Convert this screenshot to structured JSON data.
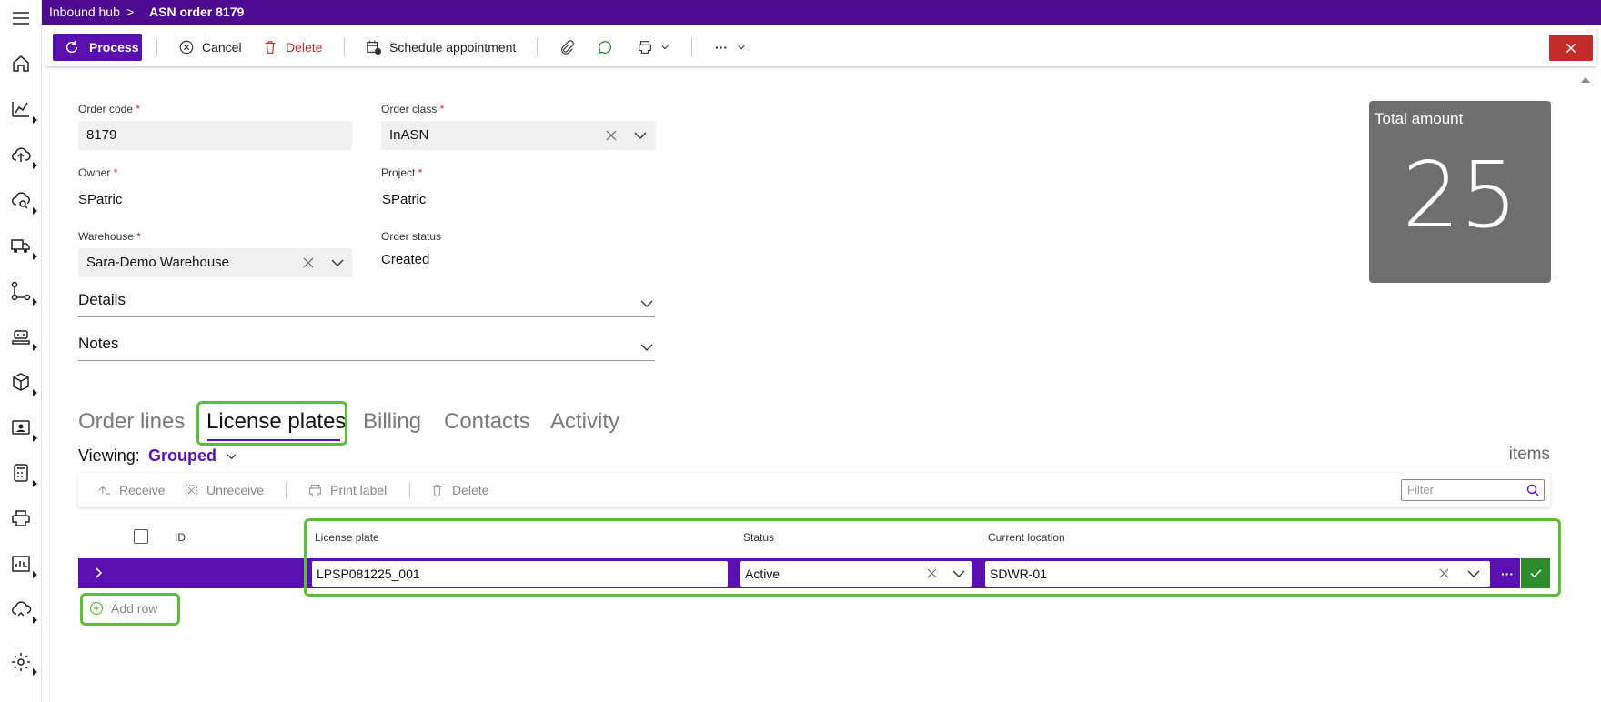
{
  "breadcrumb": {
    "parent": "Inbound hub",
    "separator": ">",
    "current": "ASN order 8179"
  },
  "toolbar": {
    "process_label": "Process",
    "cancel_label": "Cancel",
    "delete_label": "Delete",
    "schedule_label": "Schedule appointment",
    "more_label": "···"
  },
  "form": {
    "order_code": {
      "label": "Order code",
      "required": "*",
      "value": "8179"
    },
    "order_class": {
      "label": "Order class",
      "required": "*",
      "value": "InASN"
    },
    "owner": {
      "label": "Owner",
      "required": "*",
      "value": "SPatric"
    },
    "project": {
      "label": "Project",
      "required": "*",
      "value": "SPatric"
    },
    "warehouse": {
      "label": "Warehouse",
      "required": "*",
      "value": "Sara-Demo Warehouse"
    },
    "order_status": {
      "label": "Order status",
      "value": "Created"
    }
  },
  "sections": {
    "details": "Details",
    "notes": "Notes"
  },
  "total_card": {
    "label": "Total amount",
    "value": "25"
  },
  "tabs": [
    {
      "label": "Order lines"
    },
    {
      "label": "License plates",
      "active": true
    },
    {
      "label": "Billing"
    },
    {
      "label": "Contacts"
    },
    {
      "label": "Activity"
    }
  ],
  "viewing": {
    "label": "Viewing:",
    "value": "Grouped"
  },
  "items_label": "items",
  "grid_toolbar": {
    "receive": "Receive",
    "unreceive": "Unreceive",
    "print_label": "Print label",
    "delete": "Delete",
    "filter_placeholder": "Filter"
  },
  "grid": {
    "columns": {
      "id": "ID",
      "license_plate": "License plate",
      "status": "Status",
      "current_location": "Current location"
    },
    "rows": [
      {
        "license_plate": "LPSP081225_001",
        "status": "Active",
        "current_location": "SDWR-01"
      }
    ],
    "more_label": "···",
    "add_row_label": "Add row"
  },
  "colors": {
    "brand": "#4b0a8f",
    "accent": "#5a10b0",
    "highlight": "#5fbb3f",
    "danger": "#c42b2b",
    "confirm": "#2e8b2e"
  },
  "rail_icons": [
    "menu-icon",
    "home-icon",
    "analytics-icon",
    "cloud-upload-icon",
    "cloud-search-icon",
    "truck-icon",
    "flow-icon",
    "robot-icon",
    "box-icon",
    "contact-icon",
    "calculator-icon",
    "printer-icon",
    "report-icon",
    "cloud-sync-icon",
    "settings-icon"
  ]
}
